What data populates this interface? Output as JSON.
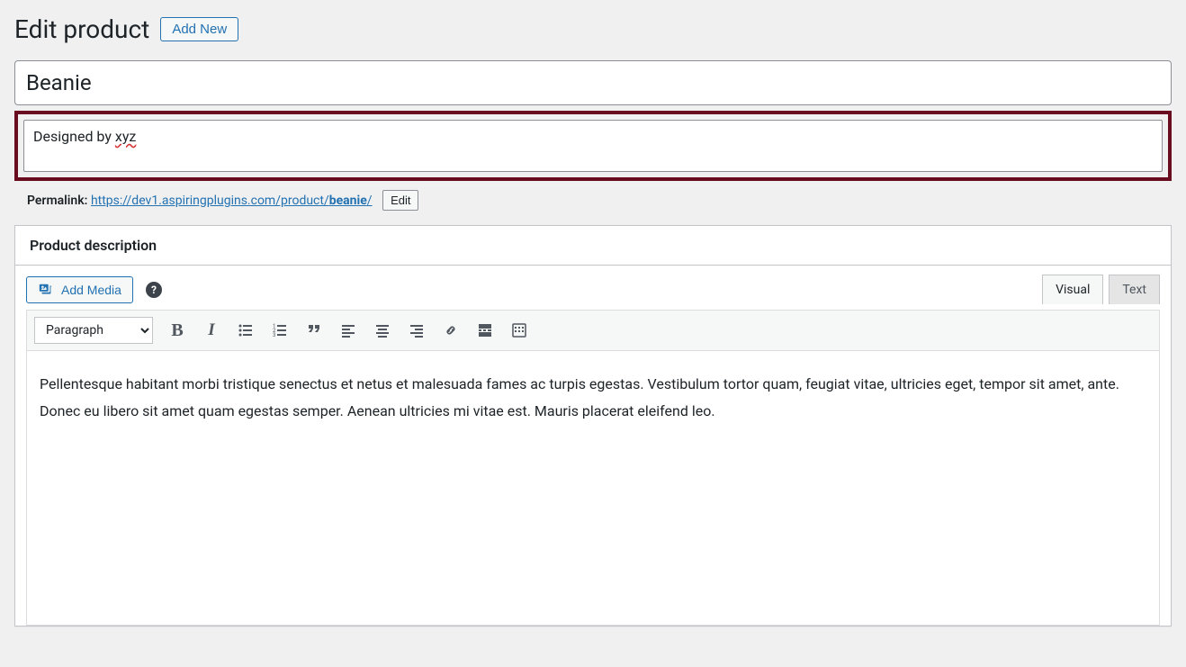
{
  "header": {
    "title": "Edit product",
    "add_new_label": "Add New"
  },
  "product": {
    "title_value": "Beanie",
    "subtitle_prefix": "Designed by ",
    "subtitle_spellcheck": "xyz"
  },
  "permalink": {
    "label": "Permalink:",
    "url_base": "https://dev1.aspiringplugins.com/product/",
    "url_slug": "beanie",
    "url_trail": "/",
    "edit_label": "Edit"
  },
  "description": {
    "panel_title": "Product description",
    "add_media_label": "Add Media",
    "tabs": {
      "visual": "Visual",
      "text": "Text"
    },
    "format_select_value": "Paragraph",
    "content": "Pellentesque habitant morbi tristique senectus et netus et malesuada fames ac turpis egestas. Vestibulum tortor quam, feugiat vitae, ultricies eget, tempor sit amet, ante. Donec eu libero sit amet quam egestas semper. Aenean ultricies mi vitae est. Mauris placerat eleifend leo."
  }
}
